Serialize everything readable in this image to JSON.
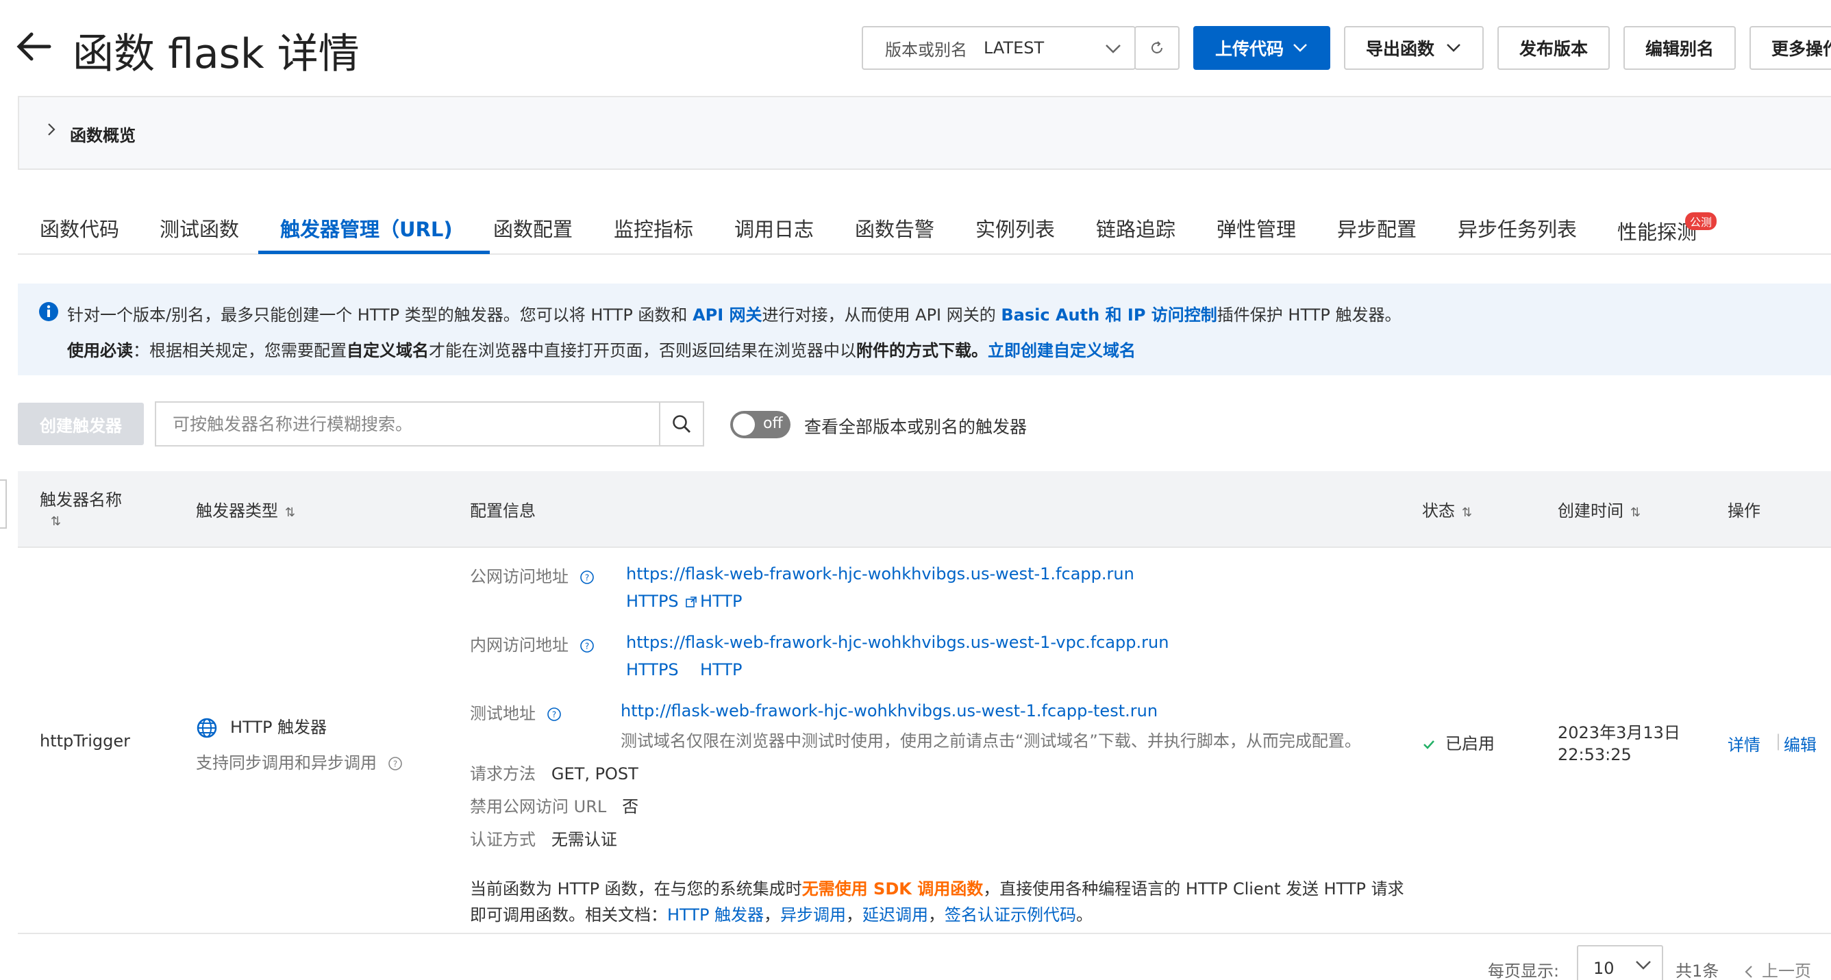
{
  "header": {
    "title": "函数 flask 详情",
    "version_label": "版本或别名",
    "version_value": "LATEST",
    "upload_label": "上传代码",
    "export_label": "导出函数",
    "publish_label": "发布版本",
    "alias_label": "编辑别名",
    "more_label": "更多操作"
  },
  "overview": {
    "label": "函数概览"
  },
  "tabs": [
    {
      "label": "函数代码"
    },
    {
      "label": "测试函数"
    },
    {
      "label": "触发器管理（URL)"
    },
    {
      "label": "函数配置"
    },
    {
      "label": "监控指标"
    },
    {
      "label": "调用日志"
    },
    {
      "label": "函数告警"
    },
    {
      "label": "实例列表"
    },
    {
      "label": "链路追踪"
    },
    {
      "label": "弹性管理"
    },
    {
      "label": "异步配置"
    },
    {
      "label": "异步任务列表"
    },
    {
      "label": "性能探测",
      "badge": "公测"
    }
  ],
  "notice": {
    "l1_a": "针对一个版本/别名，最多只能创建一个 HTTP 类型的触发器。您可以将 HTTP 函数和 ",
    "l1_link1": "API 网关",
    "l1_b": "进行对接，从而使用 API 网关的 ",
    "l1_link2": "Basic Auth 和 IP 访问控制",
    "l1_c": "插件保护 HTTP 触发器。",
    "l2_bold1": "使用必读",
    "l2_a": "：根据相关规定，您需要配置",
    "l2_bold2": "自定义域名",
    "l2_b": "才能在浏览器中直接打开页面，否则返回结果在浏览器中以",
    "l2_bold3": "附件的方式下载。",
    "l2_link": "立即创建自定义域名"
  },
  "toolbar": {
    "create_label": "创建触发器",
    "search_placeholder": "可按触发器名称进行模糊搜索。",
    "toggle_text": "off",
    "toggle_label": "查看全部版本或别名的触发器"
  },
  "table": {
    "headers": {
      "name": "触发器名称",
      "type": "触发器类型",
      "config": "配置信息",
      "status": "状态",
      "created": "创建时间",
      "actions": "操作"
    },
    "row": {
      "name": "httpTrigger",
      "type": "HTTP 触发器",
      "type_desc": "支持同步调用和异步调用",
      "public_label": "公网访问地址",
      "public_url": "https://flask-web-frawork-hjc-wohkhvibgs.us-west-1.fcapp.run",
      "public_https": "HTTPS",
      "public_http": "HTTP",
      "private_label": "内网访问地址",
      "private_url": "https://flask-web-frawork-hjc-wohkhvibgs.us-west-1-vpc.fcapp.run",
      "private_https": "HTTPS",
      "private_http": "HTTP",
      "test_label": "测试地址",
      "test_url": "http://flask-web-frawork-hjc-wohkhvibgs.us-west-1.fcapp-test.run",
      "test_note": "测试域名仅限在浏览器中测试时使用，使用之前请点击“测试域名”下载、并执行脚本，从而完成配置。",
      "method_label": "请求方法",
      "method_value": "GET, POST",
      "disable_label": "禁用公网访问 URL",
      "disable_value": "否",
      "auth_label": "认证方式",
      "auth_value": "无需认证",
      "footer_a": "当前函数为 HTTP 函数，在与您的系统集成时",
      "footer_orange": "无需使用 SDK 调用函数",
      "footer_b": "，直接使用各种编程语言的 HTTP Client 发送 HTTP 请求",
      "footer_c": "即可调用函数。相关文档：",
      "doc1": "HTTP 触发器",
      "sep1": "，",
      "doc2": "异步调用",
      "sep2": "，",
      "doc3": "延迟调用",
      "sep3": "，",
      "doc4": "签名认证示例代码",
      "end": "。",
      "status": "已启用",
      "created_date": "2023年3月13日",
      "created_time": "22:53:25",
      "action_detail": "详情",
      "action_edit": "编辑"
    }
  },
  "pagination": {
    "per_page_label": "每页显示:",
    "per_page_value": "10",
    "total": "共1条",
    "prev": "上一页"
  },
  "colors": {
    "primary": "#0064c8",
    "orange": "#ff6a00",
    "success": "#23b066"
  }
}
